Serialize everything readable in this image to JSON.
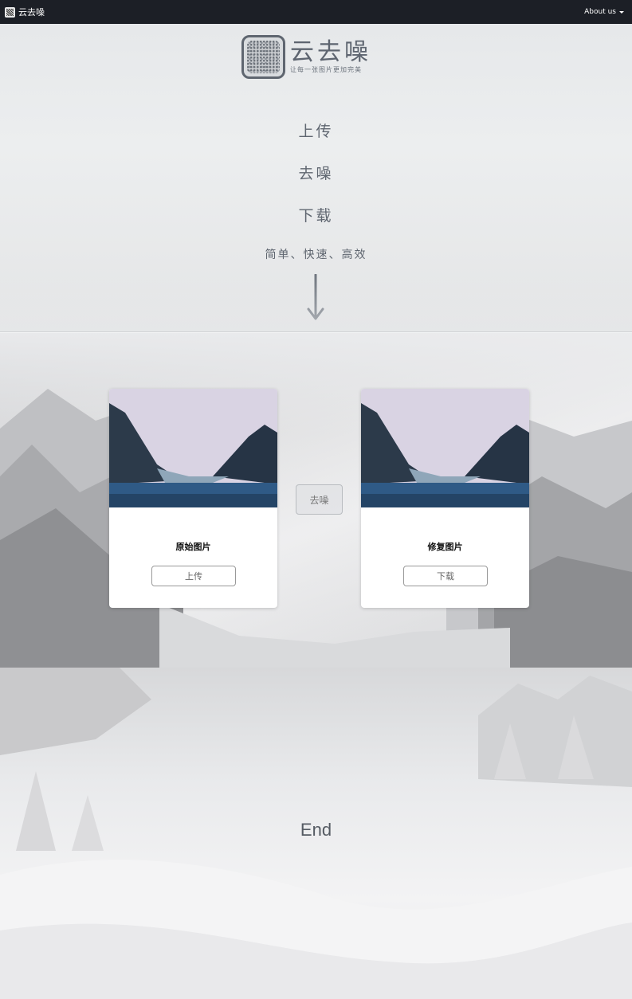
{
  "navbar": {
    "brand": "云去噪",
    "about": "About us"
  },
  "hero": {
    "logo_title": "云去噪",
    "logo_subtitle": "让每一张图片更加完美",
    "step1": "上传",
    "step2": "去噪",
    "step3": "下载",
    "tagline": "简单、快速、高效"
  },
  "cards": {
    "original": {
      "title": "原始图片",
      "button": "上传"
    },
    "restored": {
      "title": "修复图片",
      "button": "下载"
    },
    "denoise_button": "去噪"
  },
  "footer": {
    "end": "End"
  }
}
